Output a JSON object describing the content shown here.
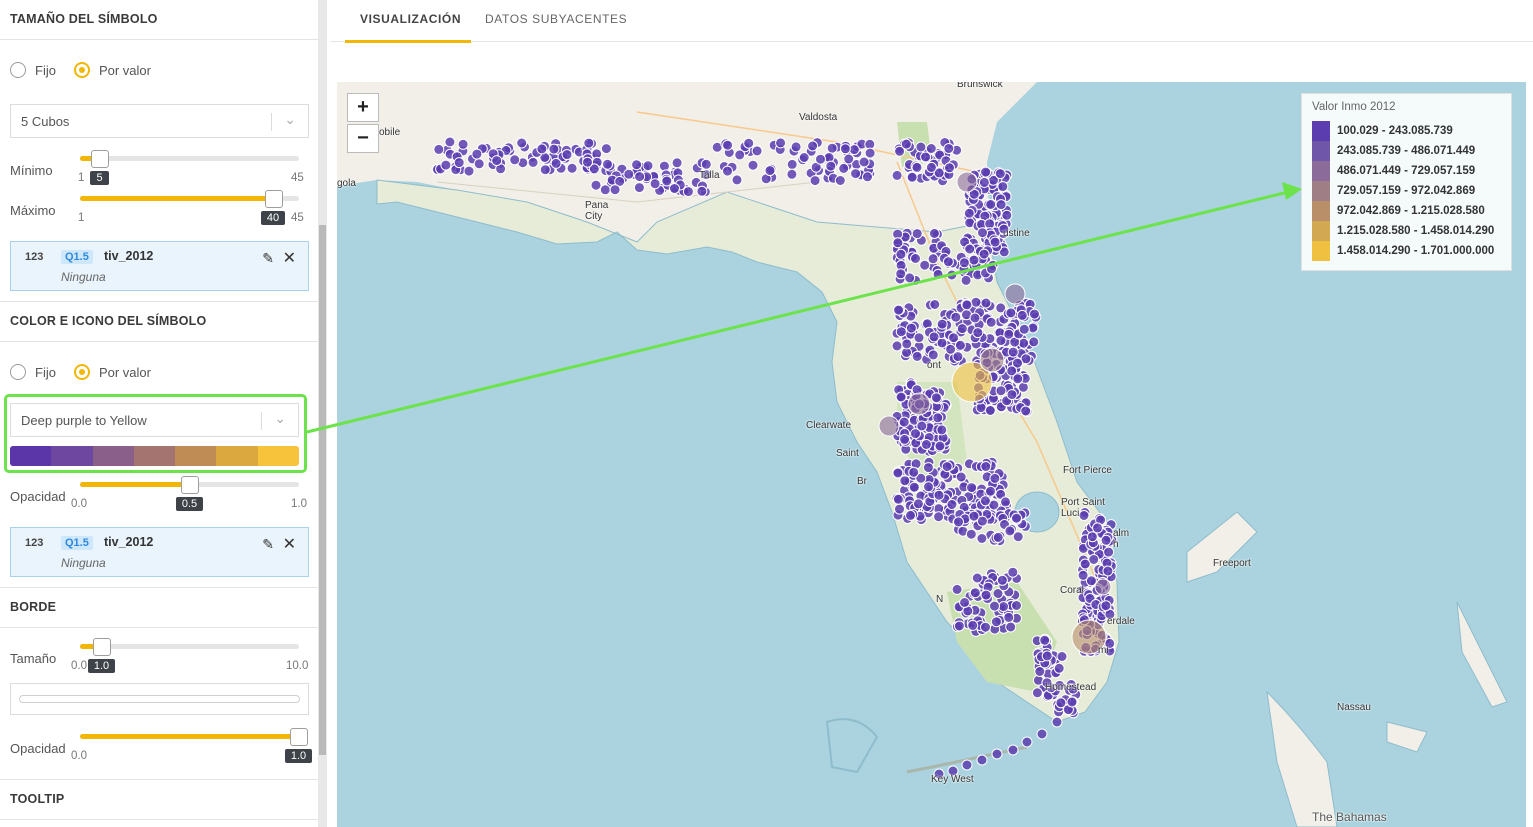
{
  "size_section": {
    "title": "TAMAÑO DEL SÍMBOLO",
    "radio_fixed": "Fijo",
    "radio_by_value": "Por valor",
    "classification": "5 Cubos",
    "min_label": "Mínimo",
    "min_value": "5",
    "min_range_low": "1",
    "min_range_high": "45",
    "max_label": "Máximo",
    "max_value": "40",
    "max_range_low": "1",
    "max_range_high": "45",
    "variable": {
      "type": "123",
      "agg": "Q1.5",
      "name": "tiv_2012",
      "sub": "Ninguna"
    }
  },
  "color_section": {
    "title": "COLOR E ICONO DEL SÍMBOLO",
    "radio_fixed": "Fijo",
    "radio_by_value": "Por valor",
    "palette": "Deep purple to Yellow",
    "ramp_colors": [
      "#5b36a8",
      "#6e48a0",
      "#8a5f8a",
      "#a47570",
      "#c08c55",
      "#dba840",
      "#f6c33a"
    ],
    "opacity_label": "Opacidad",
    "opacity_value": "0.5",
    "opacity_low": "0.0",
    "opacity_high": "1.0",
    "variable": {
      "type": "123",
      "agg": "Q1.5",
      "name": "tiv_2012",
      "sub": "Ninguna"
    }
  },
  "border_section": {
    "title": "BORDE",
    "size_label": "Tamaño",
    "size_value": "1.0",
    "size_low": "0.0",
    "size_high": "10.0",
    "opacity_label": "Opacidad",
    "opacity_value": "1.0",
    "opacity_low": "0.0"
  },
  "tooltip_section": {
    "title": "TOOLTIP"
  },
  "tabs": {
    "visualization": "VISUALIZACIÓN",
    "underlying": "DATOS SUBYACENTES"
  },
  "map": {
    "zoom_in": "+",
    "zoom_out": "−",
    "legend": {
      "title": "Valor Inmo 2012",
      "entries": [
        {
          "label": "100.029 - 243.085.739",
          "color": "#5b3db0"
        },
        {
          "label": "243.085.739 - 486.071.449",
          "color": "#6f56a8"
        },
        {
          "label": "486.071.449 - 729.057.159",
          "color": "#8a6b9a"
        },
        {
          "label": "729.057.159 - 972.042.869",
          "color": "#a07e85"
        },
        {
          "label": "972.042.869 - 1.215.028.580",
          "color": "#b98f6a"
        },
        {
          "label": "1.215.028.580 - 1.458.014.290",
          "color": "#d3a853"
        },
        {
          "label": "1.458.014.290 - 1.701.000.000",
          "color": "#f0c140"
        }
      ]
    },
    "places": {
      "brunswick": "Brunswick",
      "valdosta": "Valdosta",
      "mobile": "obile",
      "pensacola": "gola",
      "tallahassee": "Talla",
      "panama_city": "Pana\nCity",
      "augustine": "ustine",
      "orlando": "ont",
      "clearwater": "Clearwate",
      "saint": "Saint",
      "palm_bay": "Palm",
      "fort_pierce": "Fort Pierce",
      "port_saint_lucie": "Port Saint\nLuci",
      "palm_beach": "alm\nh",
      "coral_springs": "Coral",
      "fort_lauderdale": "erdale",
      "miami": "mi",
      "homestead": "Homestead",
      "key_west": "Key West",
      "freeport": "Freeport",
      "nassau": "Nassau",
      "bahamas": "The Bahamas",
      "naples": "N",
      "bradenton": "Br"
    }
  }
}
